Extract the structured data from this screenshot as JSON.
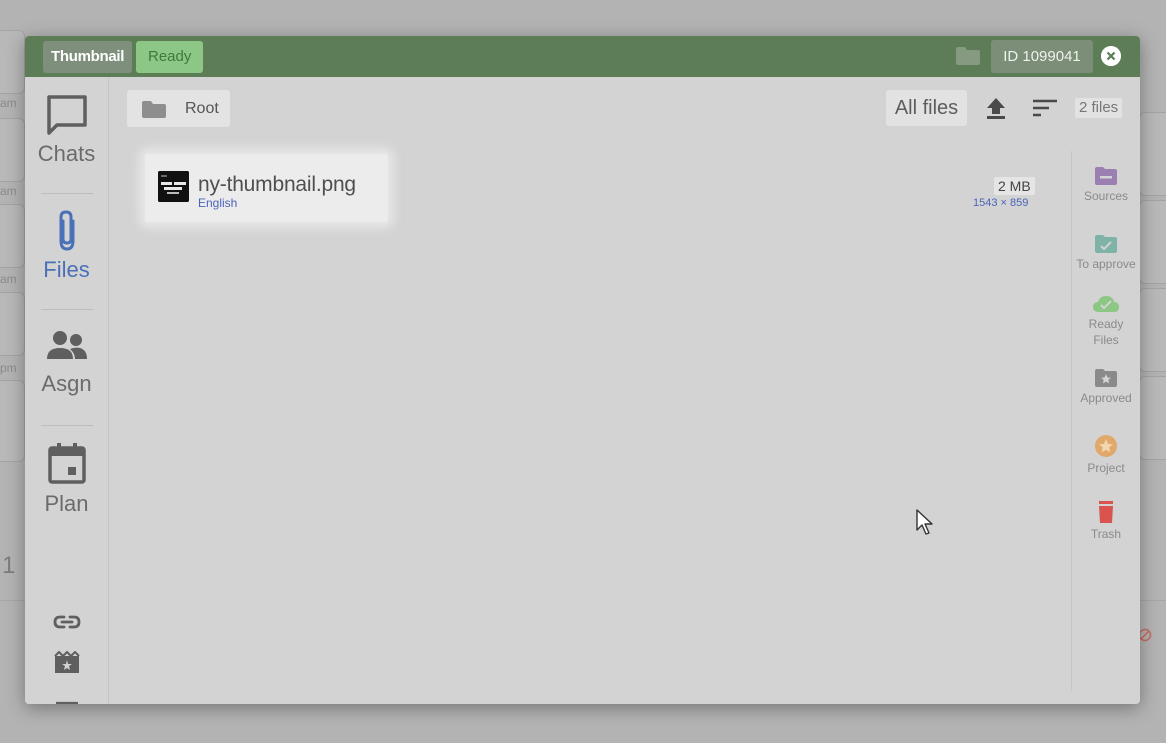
{
  "background": {
    "times": [
      "am",
      "am",
      "am",
      "pm"
    ],
    "count_digit": "1"
  },
  "header": {
    "tag_label": "Thumbnail",
    "status_label": "Ready",
    "id_label": "ID 1099041",
    "colors": {
      "bar": "#5c7d56",
      "status_bg": "#8cc785"
    }
  },
  "leftnav": {
    "items": [
      {
        "label": "Chats",
        "icon": "chat-bubble-icon",
        "active": false
      },
      {
        "label": "Files",
        "icon": "paperclip-icon",
        "active": true
      },
      {
        "label": "Asgn",
        "icon": "people-icon",
        "active": false
      },
      {
        "label": "Plan",
        "icon": "calendar-icon",
        "active": false
      }
    ],
    "tools": [
      "link-icon",
      "movie-edit-icon",
      "filter-icon"
    ]
  },
  "toolbar": {
    "breadcrumb_label": "Root",
    "filter_label": "All files",
    "file_count": "2 files"
  },
  "files": [
    {
      "name": "ny-thumbnail.png",
      "language": "English",
      "size": "2 MB",
      "dimensions": "1543 × 859"
    }
  ],
  "rail": {
    "items": [
      {
        "label": "Sources",
        "icon": "sources-folder-icon",
        "color": "#9a7fb0"
      },
      {
        "label": "To approve",
        "icon": "to-approve-folder-icon",
        "color": "#7fb3a8"
      },
      {
        "label": "Ready Files",
        "icon": "cloud-check-icon",
        "color": "#8cc785"
      },
      {
        "label": "Approved",
        "icon": "star-folder-icon",
        "color": "#8a8a8a"
      },
      {
        "label": "Project",
        "icon": "star-circle-icon",
        "color": "#e0a86a"
      },
      {
        "label": "Trash",
        "icon": "trash-icon",
        "color": "#d9534f"
      }
    ]
  }
}
